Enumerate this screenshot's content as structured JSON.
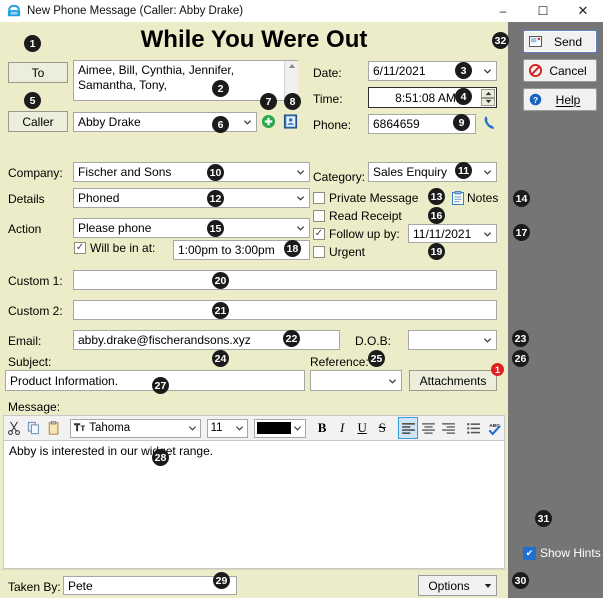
{
  "window": {
    "title": "New Phone Message (Caller: Abby Drake)",
    "icon": "phone-icon",
    "minimize": "–",
    "maximize": "☐",
    "close": "✕"
  },
  "header": {
    "title": "While You Were Out"
  },
  "form": {
    "to_button": "To",
    "to_value": "Aimee, Bill, Cynthia, Jennifer, Samantha, Tony,",
    "caller_button": "Caller",
    "caller_value": "Abby Drake",
    "company_label": "Company:",
    "company_value": "Fischer and Sons",
    "details_label": "Details",
    "details_value": "Phoned",
    "action_label": "Action",
    "action_value": "Please phone",
    "will_be_in_label": "Will be in at:",
    "will_be_in_checked": true,
    "will_be_in_value": "1:00pm to 3:00pm",
    "custom1_label": "Custom 1:",
    "custom1_value": "",
    "custom2_label": "Custom 2:",
    "custom2_value": "",
    "email_label": "Email:",
    "email_value": "abby.drake@fischerandsons.xyz",
    "dob_label": "D.O.B:",
    "dob_value": "",
    "subject_label": "Subject:",
    "subject_value": "Product Information.",
    "reference_label": "Reference:",
    "reference_value": "",
    "attachments_button": "Attachments",
    "attachments_count": "1",
    "message_label": "Message:",
    "message_body": "Abby is interested in our widget range.",
    "taken_by_label": "Taken By:",
    "taken_by_value": "Pete",
    "options_button": "Options"
  },
  "right_form": {
    "date_label": "Date:",
    "date_value": "6/11/2021",
    "time_label": "Time:",
    "time_value": "8:51:08 AM",
    "phone_label": "Phone:",
    "phone_value": "6864659",
    "category_label": "Category:",
    "category_value": "Sales Enquiry",
    "private_message": "Private Message",
    "private_message_checked": false,
    "read_receipt": "Read Receipt",
    "read_receipt_checked": false,
    "follow_up": "Follow up by:",
    "follow_up_checked": true,
    "follow_up_value": "11/11/2021",
    "urgent": "Urgent",
    "urgent_checked": false,
    "notes_button": "Notes"
  },
  "sidebar": {
    "send": "Send",
    "cancel": "Cancel",
    "help": "Help",
    "show_hints": "Show Hints",
    "show_hints_checked": true
  },
  "editor_toolbar": {
    "cut": "cut-icon",
    "copy": "copy-icon",
    "paste": "paste-icon",
    "font_family": "Tahoma",
    "font_size": "11",
    "font_color": "#000000",
    "bold": "B",
    "italic": "I",
    "underline": "U",
    "strike": "S",
    "align_left": "align-left-icon",
    "align_center": "align-center-icon",
    "align_right": "align-right-icon",
    "bullets": "bullet-list-icon",
    "spellcheck": "spellcheck-icon"
  },
  "badges": {
    "b1": "1",
    "b2": "2",
    "b3": "3",
    "b4": "4",
    "b5": "5",
    "b6": "6",
    "b7": "7",
    "b8": "8",
    "b9": "9",
    "b10": "10",
    "b11": "11",
    "b12": "12",
    "b13": "13",
    "b14": "14",
    "b15": "15",
    "b16": "16",
    "b17": "17",
    "b18": "18",
    "b19": "19",
    "b20": "20",
    "b21": "21",
    "b22": "22",
    "b23": "23",
    "b24": "24",
    "b25": "25",
    "b26": "26",
    "b27": "27",
    "b28": "28",
    "b29": "29",
    "b30": "30",
    "b31": "31",
    "b32": "32"
  },
  "colors": {
    "form_bg": "#ecedc8",
    "sidebar_bg": "#757575",
    "accent_blue": "#1f6fd0",
    "alert_red": "#e02020"
  }
}
